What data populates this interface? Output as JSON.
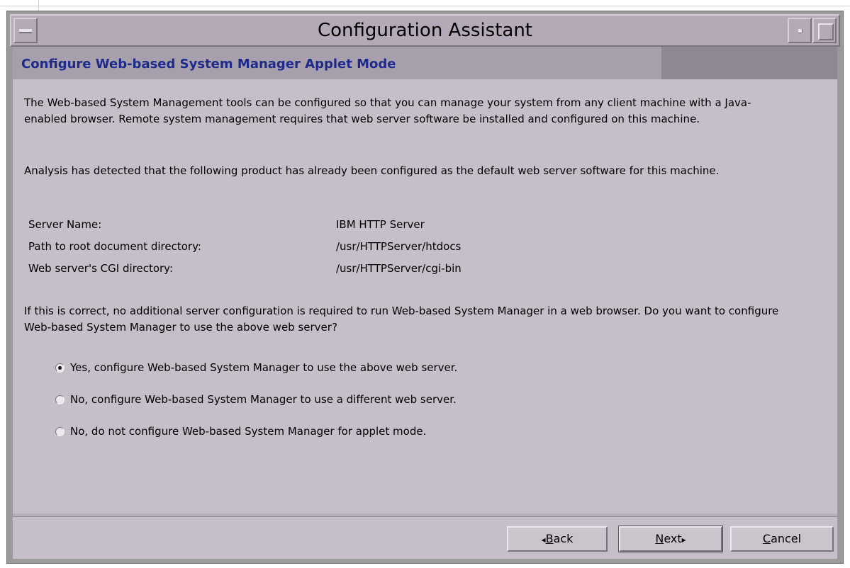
{
  "window": {
    "title": "Configuration Assistant"
  },
  "header": {
    "title": "Configure Web-based System Manager Applet Mode"
  },
  "body": {
    "intro": "The Web-based System Management tools can be configured so that you can manage your system from any client machine with a Java-enabled browser.  Remote system management requires that web server software be installed and configured on this machine.",
    "analysis": "Analysis has detected that the following product has already been configured as the default web server software for this machine.",
    "info": [
      {
        "label": "Server Name:",
        "value": "IBM HTTP Server"
      },
      {
        "label": "Path to root document directory:",
        "value": "/usr/HTTPServer/htdocs"
      },
      {
        "label": "Web server's CGI directory:",
        "value": "/usr/HTTPServer/cgi-bin"
      }
    ],
    "question": "If this is correct, no additional server configuration is required to run Web-based System Manager in a web browser.  Do you want to configure Web-based System Manager to use the above web server?",
    "options": [
      {
        "label": "Yes, configure Web-based System Manager to use the above web server.",
        "checked": true
      },
      {
        "label": "No, configure Web-based System Manager to use a different web server.",
        "checked": false
      },
      {
        "label": "No, do not configure Web-based System Manager for applet mode.",
        "checked": false
      }
    ]
  },
  "footer": {
    "back": {
      "arrow": "◂",
      "mnemonic": "B",
      "rest": "ack"
    },
    "next": {
      "mnemonic": "N",
      "rest": "ext",
      "arrow": "▸"
    },
    "cancel": {
      "mnemonic": "C",
      "rest": "ancel"
    }
  }
}
